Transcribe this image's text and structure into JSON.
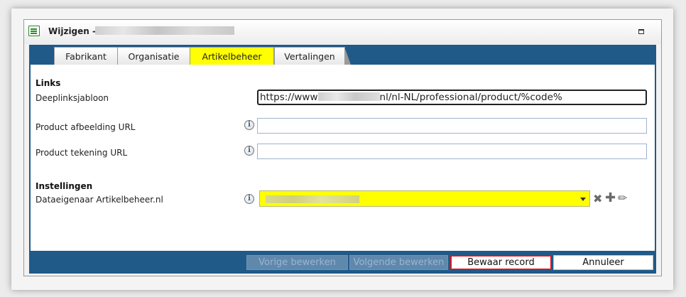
{
  "dialog": {
    "title": "Wijzigen -",
    "title_icon": "form-icon",
    "maximize_icon": "maximize-icon"
  },
  "tabs": [
    {
      "label": "Fabrikant",
      "active": false
    },
    {
      "label": "Organisatie",
      "active": false
    },
    {
      "label": "Artikelbeheer",
      "active": true
    },
    {
      "label": "Vertalingen",
      "active": false
    }
  ],
  "links_section": {
    "heading": "Links",
    "deeplink": {
      "label": "Deeplinksjabloon",
      "value_prefix": "https://www",
      "value_suffix": "nl/nl-NL/professional/product/%code%"
    },
    "image_url": {
      "label": "Product afbeelding URL",
      "value": ""
    },
    "drawing_url": {
      "label": "Product tekening URL",
      "value": ""
    }
  },
  "settings_section": {
    "heading": "Instellingen",
    "data_owner": {
      "label": "Dataeigenaar Artikelbeheer.nl",
      "value": ""
    }
  },
  "info_glyph": "i",
  "footer": {
    "prev_label": "Vorige bewerken",
    "next_label": "Volgende bewerken",
    "save_label": "Bewaar record",
    "cancel_label": "Annuleer"
  },
  "colors": {
    "accent": "#1f5a89",
    "highlight": "#ffff00",
    "save_border": "#e0141e"
  }
}
